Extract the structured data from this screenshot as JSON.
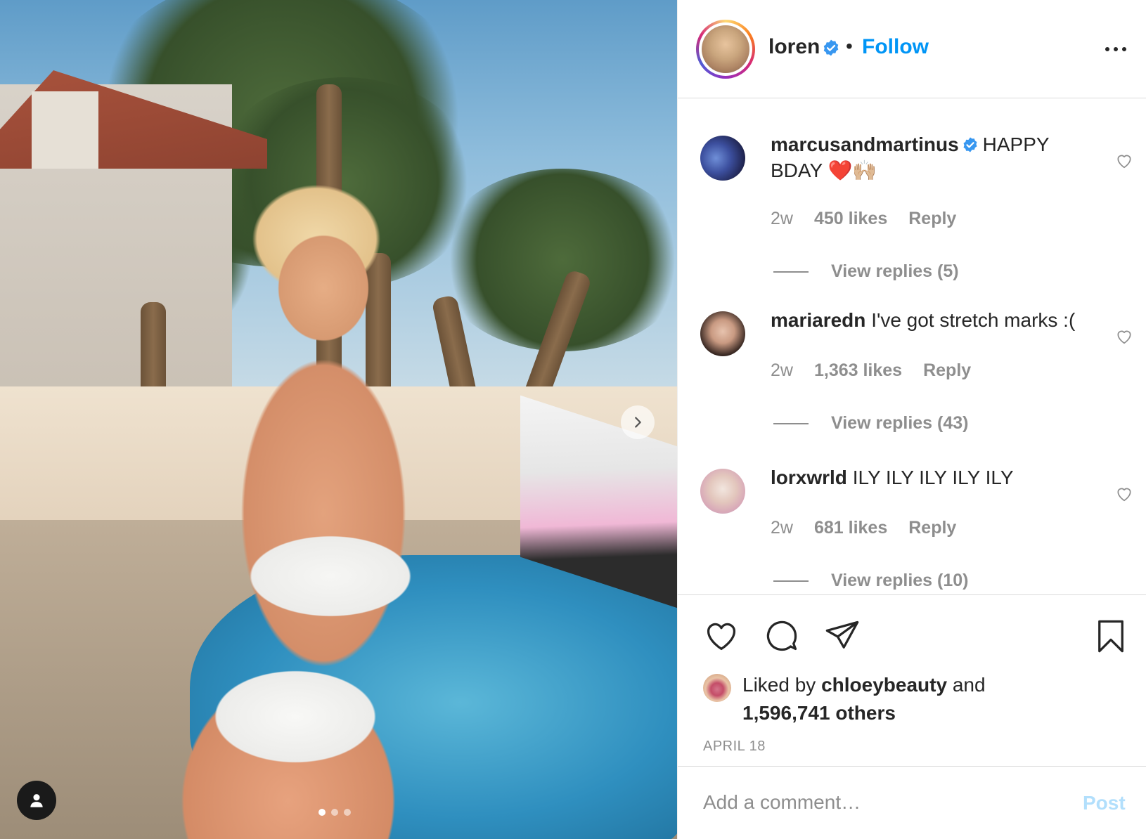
{
  "post": {
    "carousel": {
      "slide_count": 3,
      "active_index": 0
    },
    "header": {
      "username": "loren",
      "separator": "•",
      "follow_label": "Follow"
    },
    "comments": [
      {
        "username": "marcusandmartinus",
        "verified": true,
        "text": "HAPPY BDAY ❤️🙌🏼",
        "time": "2w",
        "likes": "450 likes",
        "reply_label": "Reply",
        "view_replies": "View replies (5)"
      },
      {
        "username": "mariaredn",
        "verified": false,
        "text": "I've got stretch marks :(",
        "time": "2w",
        "likes": "1,363 likes",
        "reply_label": "Reply",
        "view_replies": "View replies (43)"
      },
      {
        "username": "lorxwrld",
        "verified": false,
        "text": "ILY ILY ILY ILY ILY",
        "time": "2w",
        "likes": "681 likes",
        "reply_label": "Reply",
        "view_replies": "View replies (10)"
      }
    ],
    "liked_by": {
      "prefix": "Liked by",
      "user": "chloeybeauty",
      "conjunction": "and",
      "others": "1,596,741 others"
    },
    "date": "APRIL 18",
    "comment_input": {
      "placeholder": "Add a comment…",
      "post_label": "Post"
    }
  },
  "colors": {
    "accent": "#0095f6",
    "text": "#262626",
    "muted": "#8e8e8e",
    "border": "#dbdbdb",
    "post_disabled": "#b2dffc",
    "verified": "#3897f0"
  },
  "icons": {
    "header_more": "more-horizontal-icon",
    "verified": "verified-badge-icon",
    "carousel_next": "chevron-right-icon",
    "tag": "user-tag-icon",
    "like": "heart-icon",
    "comment": "comment-bubble-icon",
    "share": "paper-plane-icon",
    "save": "bookmark-icon",
    "comment_like": "small-heart-icon"
  }
}
